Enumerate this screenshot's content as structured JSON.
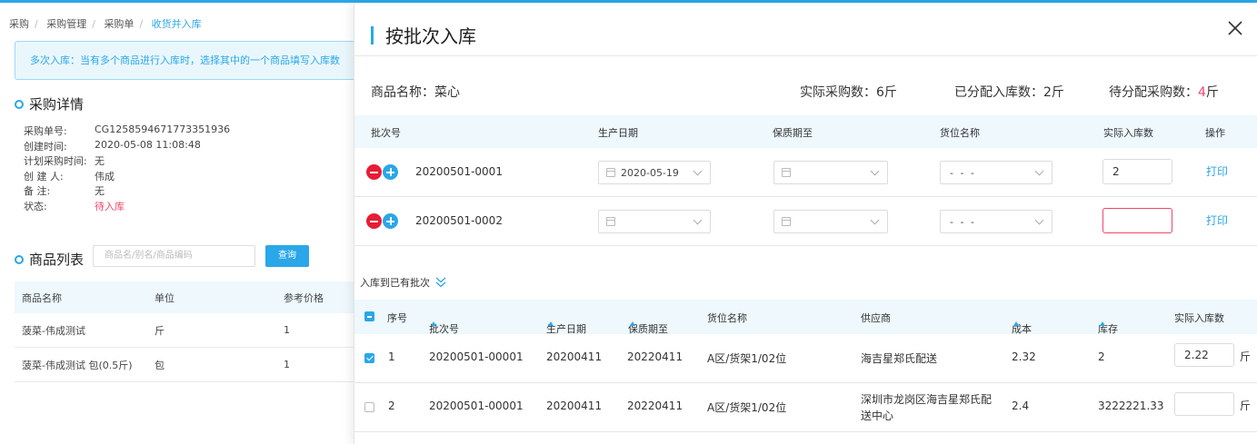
{
  "breadcrumb": [
    "采购",
    "采购管理",
    "采购单",
    "收货并入库"
  ],
  "banner": "多次入库：当有多个商品进行入库时，选择其中的一个商品填写入库数",
  "detail": {
    "title": "采购详情",
    "rows": [
      {
        "label": "采购单号:",
        "value": "CG1258594671773351936"
      },
      {
        "label": "创建时间:",
        "value": "2020-05-08 11:08:48"
      },
      {
        "label": "计划采购时间:",
        "value": "无"
      },
      {
        "label": "创 建 人:",
        "value": "伟成"
      },
      {
        "label": "备 注:",
        "value": "无"
      },
      {
        "label": "状态:",
        "value": "待入库"
      }
    ]
  },
  "product_list": {
    "title": "商品列表",
    "search_placeholder": "商品名/别名/商品编码",
    "query_label": "查询",
    "headers": [
      "商品名称",
      "单位",
      "参考价格"
    ],
    "rows": [
      [
        "菠菜-伟成测试",
        "斤",
        "1"
      ],
      [
        "菠菜-伟成测试 包(0.5斤)",
        "包",
        "1"
      ]
    ]
  },
  "modal": {
    "title": "按批次入库",
    "product_name": "商品名称：菜心",
    "actual_label": "实际采购数：6斤",
    "allocated_label": "已分配入库数：2斤",
    "pending_label": "待分配采购数：",
    "pending_value": "4",
    "pending_unit": "斤",
    "batch_headers": [
      "批次号",
      "生产日期",
      "保质期至",
      "货位名称",
      "实际入库数",
      "操作"
    ],
    "batch_rows": [
      {
        "batch": "20200501-0001",
        "prod_date": "2020-05-19",
        "expiry": "",
        "location": "- - -",
        "qty": "2",
        "action": "打印"
      },
      {
        "batch": "20200501-0002",
        "prod_date": "",
        "expiry": "",
        "location": "- - -",
        "qty": "",
        "action": "打印"
      }
    ],
    "existing_label": "入库到已有批次",
    "existing_headers": [
      "序号",
      "批次号",
      "生产日期",
      "保质期至",
      "货位名称",
      "供应商",
      "成本",
      "库存",
      "实际入库数"
    ],
    "existing_rows": [
      {
        "idx": "1",
        "batch": "20200501-00001",
        "prod": "20200411",
        "expiry": "20220411",
        "location": "A区/货架1/02位",
        "supplier": "海吉星郑氏配送",
        "supplier2": "",
        "cost": "2.32",
        "stock": "2",
        "qty": "2.22",
        "unit": "斤",
        "checked": true
      },
      {
        "idx": "2",
        "batch": "20200501-00001",
        "prod": "20200411",
        "expiry": "20220411",
        "location": "A区/货架1/02位",
        "supplier": "深圳市龙岗区海吉星郑氏配",
        "supplier2": "送中心",
        "cost": "2.4",
        "stock": "3222221.33",
        "qty": "",
        "unit": "斤",
        "checked": false
      }
    ]
  },
  "colors": {
    "accent": "#2aa7e8",
    "danger": "#f0466c",
    "minus": "#e61d35"
  }
}
